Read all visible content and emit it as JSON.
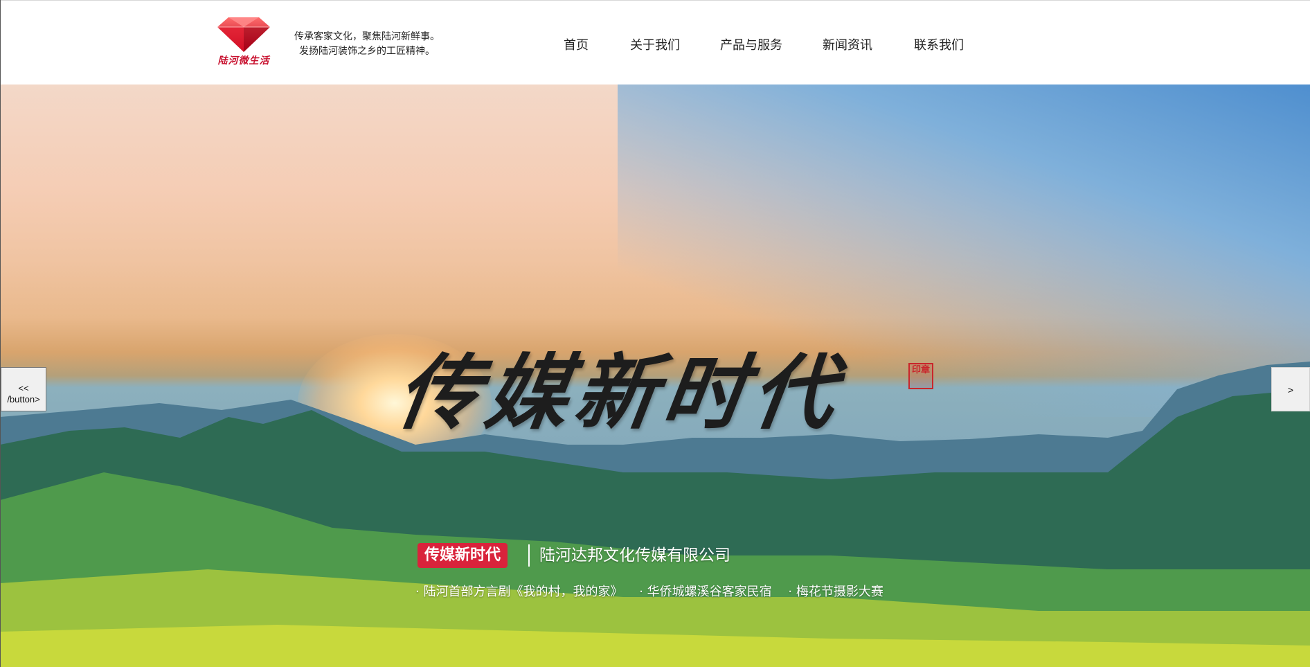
{
  "header": {
    "logo_text": "陆河微生活",
    "slogan_line1": "传承客家文化，聚焦陆河新鲜事。",
    "slogan_line2": "发扬陆河装饰之乡的工匠精神。",
    "nav": [
      {
        "label": "首页"
      },
      {
        "label": "关于我们"
      },
      {
        "label": "产品与服务"
      },
      {
        "label": "新闻资讯"
      },
      {
        "label": "联系我们"
      }
    ]
  },
  "hero": {
    "calligraphy": "传媒新时代",
    "seal": "印章",
    "badge": "传媒新时代",
    "company": "陆河达邦文化传媒有限公司",
    "highlights": [
      "· 陆河首部方言剧《我的村，我的家》",
      "· 华侨城螺溪谷客家民宿",
      "· 梅花节摄影大赛"
    ]
  },
  "carousel": {
    "prev_label": "<<\n/button>",
    "next_label": ">"
  },
  "colors": {
    "accent_red": "#d9233b",
    "logo_red": "#c8102e"
  }
}
